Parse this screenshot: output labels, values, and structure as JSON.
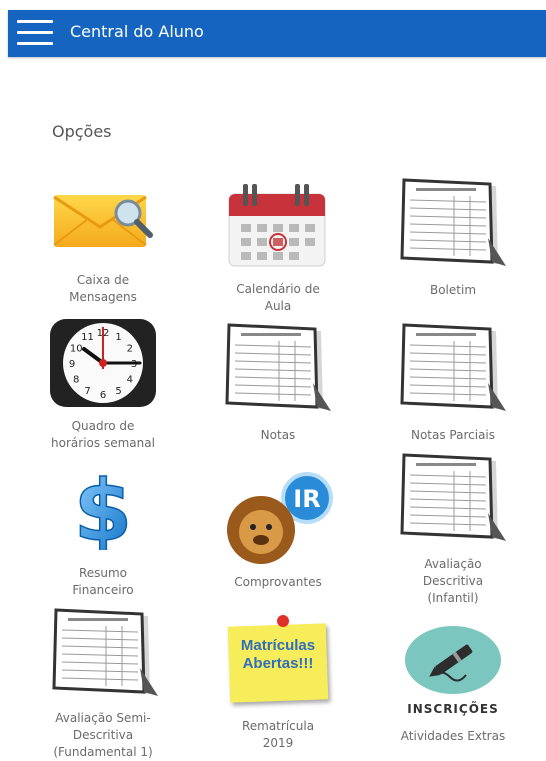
{
  "header": {
    "title": "Central do Aluno",
    "menu_icon": "hamburger-menu-icon",
    "background": "#1565c0"
  },
  "section_title": "Opções",
  "tiles": [
    {
      "label": "Caixa de\nMensagens",
      "icon": "envelope-search-icon"
    },
    {
      "label": "Calendário de\nAula",
      "icon": "calendar-icon"
    },
    {
      "label": "Boletim",
      "icon": "report-sheet-icon"
    },
    {
      "label": "Quadro de\nhorários semanal",
      "icon": "clock-icon"
    },
    {
      "label": "Notas",
      "icon": "report-sheet-icon"
    },
    {
      "label": "Notas Parciais",
      "icon": "report-sheet-icon"
    },
    {
      "label": "Resumo\nFinanceiro",
      "icon": "dollar-icon"
    },
    {
      "label": "Comprovantes",
      "icon": "lion-ir-icon"
    },
    {
      "label": "Avaliação\nDescritiva\n(Infantil)",
      "icon": "report-sheet-icon"
    },
    {
      "label": "Avaliação Semi-\nDescritiva\n(Fundamental 1)",
      "icon": "report-sheet-icon"
    },
    {
      "label": "Rematrícula\n2019",
      "icon": "sticky-note-icon"
    },
    {
      "label": "Atividades Extras",
      "icon": "pen-circle-icon"
    }
  ],
  "sticky_note_text": "Matrículas\nAbertas!!!",
  "inscricoes_text": "INSCRIÇÕES",
  "clock_numbers": [
    "12",
    "1",
    "2",
    "3",
    "4",
    "5",
    "6",
    "7",
    "8",
    "9",
    "10",
    "11"
  ]
}
